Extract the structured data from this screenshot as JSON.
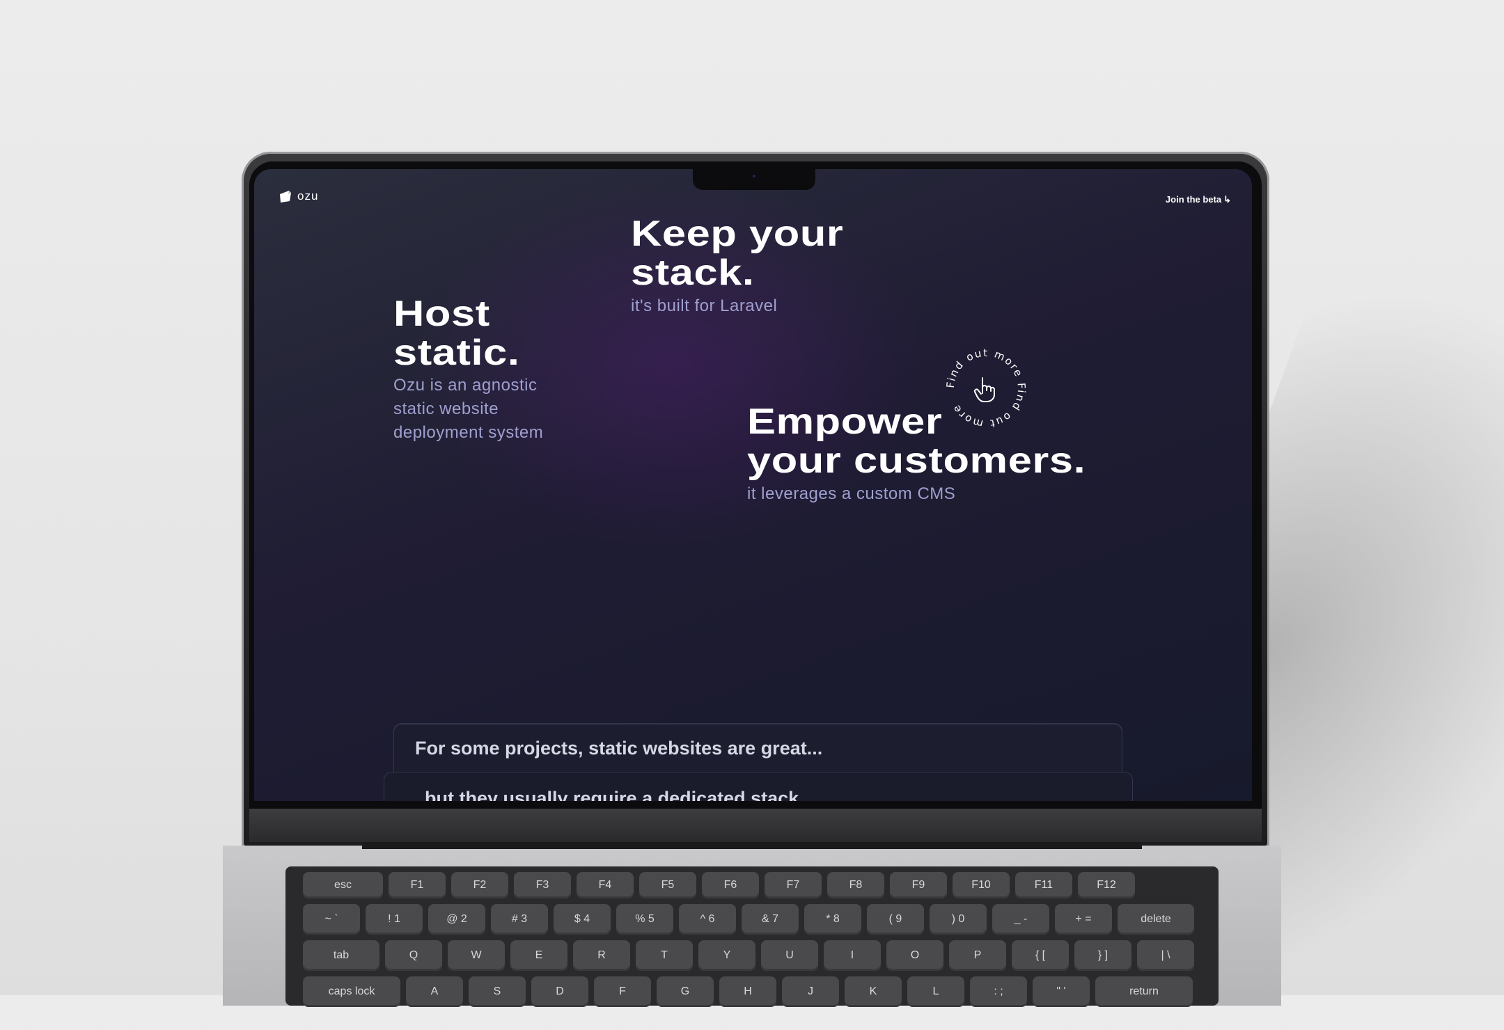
{
  "site": {
    "logo_text": "ozu",
    "nav_cta": "Join the beta",
    "nav_cta_arrow": "↳"
  },
  "hero": {
    "block1": {
      "title_line1": "Host",
      "title_line2": "static.",
      "sub_line1": "Ozu is an agnostic",
      "sub_line2": "static website",
      "sub_line3": "deployment system"
    },
    "block2": {
      "title_line1": "Keep your",
      "title_line2": "stack.",
      "sub": "it's built for Laravel"
    },
    "block3": {
      "title_line1": "Empower",
      "title_line2": "your customers.",
      "sub": "it leverages a custom CMS"
    },
    "badge_text": "Find out more Find out more"
  },
  "cards": [
    {
      "text": "For some projects, static websites are great..."
    },
    {
      "text": "but they usually require a dedicated stack"
    }
  ],
  "keyboard": {
    "fn_row": [
      "esc",
      "F1",
      "F2",
      "F3",
      "F4",
      "F5",
      "F6",
      "F7",
      "F8",
      "F9",
      "F10",
      "F11",
      "F12"
    ],
    "num_row": [
      "~ `",
      "! 1",
      "@ 2",
      "# 3",
      "$ 4",
      "% 5",
      "^ 6",
      "& 7",
      "* 8",
      "( 9",
      ") 0",
      "_ -",
      "+ =",
      "delete"
    ],
    "q_row": [
      "tab",
      "Q",
      "W",
      "E",
      "R",
      "T",
      "Y",
      "U",
      "I",
      "O",
      "P",
      "{ [",
      "} ]",
      "| \\"
    ],
    "a_row": [
      "caps lock",
      "A",
      "S",
      "D",
      "F",
      "G",
      "H",
      "J",
      "K",
      "L",
      ": ;",
      "\" '",
      "return"
    ]
  },
  "colors": {
    "accent_text": "#9fa0cf",
    "screen_bg": "#1f1c33"
  }
}
